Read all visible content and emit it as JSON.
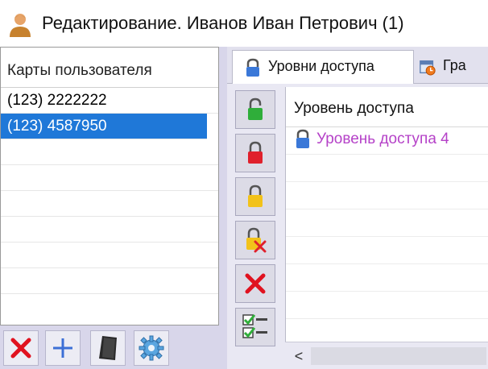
{
  "window": {
    "title": "Редактирование. Иванов Иван Петрович (1)",
    "icon": "user-icon"
  },
  "cards_panel": {
    "header": "Карты пользователя",
    "cards": [
      {
        "label": "(123) 2222222",
        "selected": false
      },
      {
        "label": "(123) 4587950",
        "selected": true
      }
    ]
  },
  "cards_toolbar": {
    "buttons": [
      {
        "name": "delete-card-button",
        "icon": "red-x-icon"
      },
      {
        "name": "add-card-button",
        "icon": "plus-icon"
      },
      {
        "name": "card-reader-button",
        "icon": "card-reader-icon"
      },
      {
        "name": "card-settings-button",
        "icon": "gear-icon"
      }
    ]
  },
  "tabs": [
    {
      "label": "Уровни доступа",
      "icon": "padlock-icon",
      "active": true
    },
    {
      "label": "Гра",
      "icon": "calendar-clock-icon",
      "active": false
    }
  ],
  "access_actions": [
    {
      "name": "grant-access-button",
      "icon": "green-unlocked-padlock-icon"
    },
    {
      "name": "deny-access-button",
      "icon": "red-locked-padlock-icon"
    },
    {
      "name": "partial-access-button",
      "icon": "yellow-padlock-icon"
    },
    {
      "name": "remove-level-button",
      "icon": "yellow-padlock-x-icon"
    },
    {
      "name": "delete-button",
      "icon": "red-x-icon"
    },
    {
      "name": "checklist-button",
      "icon": "checklist-icon"
    }
  ],
  "access_list": {
    "header": "Уровень доступа",
    "rows": [
      {
        "label": "Уровень доступа 4",
        "icon": "padlock-icon"
      }
    ],
    "scroll_left": "<"
  },
  "colors": {
    "selection": "#1f78d8",
    "access_level_text": "#b542c8",
    "toolbar_bg": "#d8d6ea"
  }
}
